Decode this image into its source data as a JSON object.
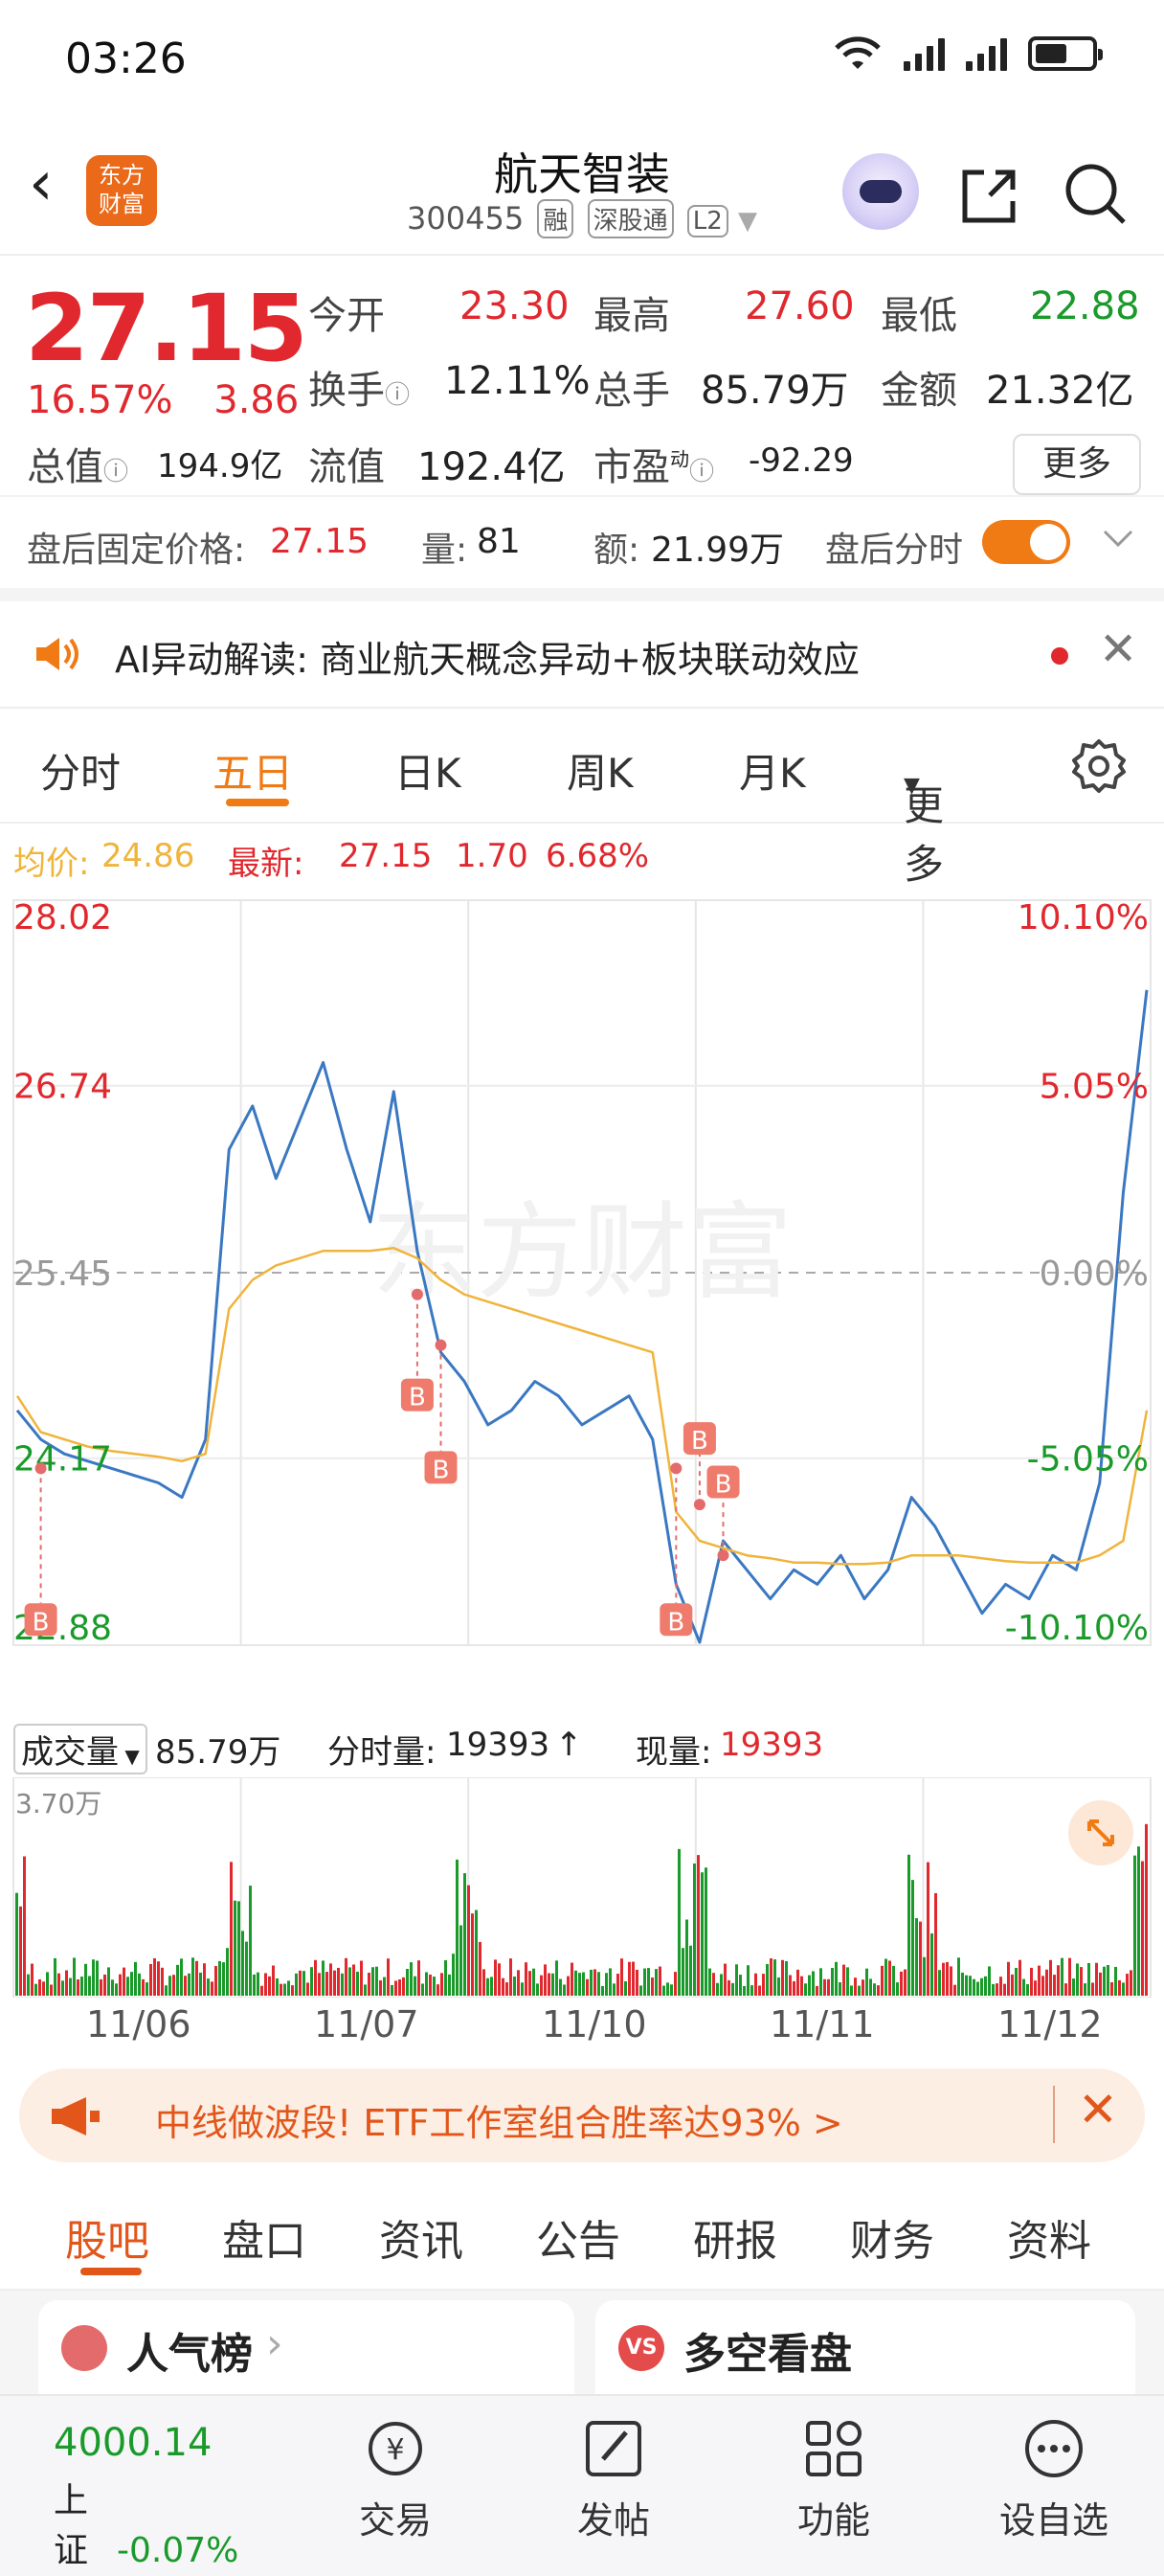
{
  "status": {
    "time": "03:26"
  },
  "header": {
    "logo_text_1": "东方",
    "logo_text_2": "财富",
    "name": "航天智装",
    "code": "300455",
    "tag1": "融",
    "tag2": "深股通",
    "tag3": "L2"
  },
  "quote": {
    "price": "27.15",
    "change_pct": "16.57%",
    "change_amt": "3.86",
    "open_label": "今开",
    "open": "23.30",
    "high_label": "最高",
    "high": "27.60",
    "low_label": "最低",
    "low": "22.88",
    "turnover_label": "换手",
    "turnover": "12.11%",
    "volume_label": "总手",
    "volume": "85.79万",
    "amount_label": "金额",
    "amount": "21.32亿",
    "mktcap_label": "总值",
    "mktcap": "194.9亿",
    "float_label": "流值",
    "float": "192.4亿",
    "pe_label": "市盈",
    "pe_sup": "动",
    "pe": "-92.29",
    "more": "更多"
  },
  "after_hours": {
    "price_label": "盘后固定价格:",
    "price": "27.15",
    "vol_label": "量:",
    "vol": "81",
    "amt_label": "额:",
    "amt": "21.99万",
    "toggle_label": "盘后分时"
  },
  "ai": {
    "text": "AI异动解读:  商业航天概念异动+板块联动效应"
  },
  "tabs": [
    "分时",
    "五日",
    "日K",
    "周K",
    "月K",
    "更多"
  ],
  "active_tab": "五日",
  "avg_line": {
    "avg_label": "均价:",
    "avg": "24.86",
    "latest_label": "最新:",
    "latest": "27.15",
    "chg": "1.70",
    "pct": "6.68%"
  },
  "watermark": "东方财富",
  "chart_data": {
    "type": "line",
    "title": "",
    "x_dates": [
      "11/06",
      "11/07",
      "11/10",
      "11/11",
      "11/12"
    ],
    "y_ticks_left": [
      "28.02",
      "26.74",
      "25.45",
      "24.17",
      "22.88"
    ],
    "y_ticks_right": [
      "10.10%",
      "5.05%",
      "0.00%",
      "-5.05%",
      "-10.10%"
    ],
    "ylim": [
      22.88,
      28.02
    ],
    "prev_close": 25.45,
    "series": [
      {
        "values": [
          24.5,
          24.3,
          24.2,
          24.15,
          24.1,
          24.05,
          24.0,
          23.9,
          24.3,
          26.3,
          26.6,
          26.1,
          26.5,
          26.9,
          26.3,
          25.8,
          26.7,
          25.6,
          24.9,
          24.7,
          24.4,
          24.5,
          24.7,
          24.6,
          24.4,
          24.5,
          24.6,
          24.3,
          23.3,
          22.9,
          23.6,
          23.4,
          23.2,
          23.4,
          23.3,
          23.5,
          23.2,
          23.4,
          23.9,
          23.7,
          23.4,
          23.1,
          23.3,
          23.2,
          23.5,
          23.4,
          24.0,
          26.0,
          27.4
        ]
      },
      {
        "values": [
          24.6,
          24.35,
          24.3,
          24.25,
          24.22,
          24.2,
          24.18,
          24.15,
          24.2,
          25.2,
          25.4,
          25.5,
          25.55,
          25.6,
          25.6,
          25.6,
          25.62,
          25.55,
          25.4,
          25.3,
          25.25,
          25.2,
          25.15,
          25.1,
          25.05,
          25.0,
          24.95,
          24.9,
          23.8,
          23.6,
          23.55,
          23.5,
          23.48,
          23.45,
          23.45,
          23.44,
          23.44,
          23.45,
          23.5,
          23.5,
          23.5,
          23.48,
          23.46,
          23.45,
          23.45,
          23.45,
          23.5,
          23.6,
          24.5
        ]
      }
    ],
    "volume": {
      "label": "成交量",
      "total": "85.79万",
      "tick_label": "分时量:",
      "tick_value": "19393",
      "now_label": "现量:",
      "now_value": "19393",
      "max_label": "3.70万"
    },
    "buy_marker": "B"
  },
  "banner": {
    "text": "中线做波段! ETF工作室组合胜率达93% >"
  },
  "bottom_tabs": [
    "股吧",
    "盘口",
    "资讯",
    "公告",
    "研报",
    "财务",
    "资料"
  ],
  "cards": {
    "left": "人气榜",
    "right": "多空看盘",
    "vs": "VS"
  },
  "index": {
    "value": "4000.14",
    "name": "上证",
    "pct": "-0.07%"
  },
  "nav": [
    "交易",
    "发帖",
    "功能",
    "设自选"
  ],
  "colors": {
    "up": "#e0282e",
    "down": "#1a9a2a",
    "accent": "#f07a14",
    "price_line": "#3a78c2",
    "avg_line": "#f0b43c"
  }
}
